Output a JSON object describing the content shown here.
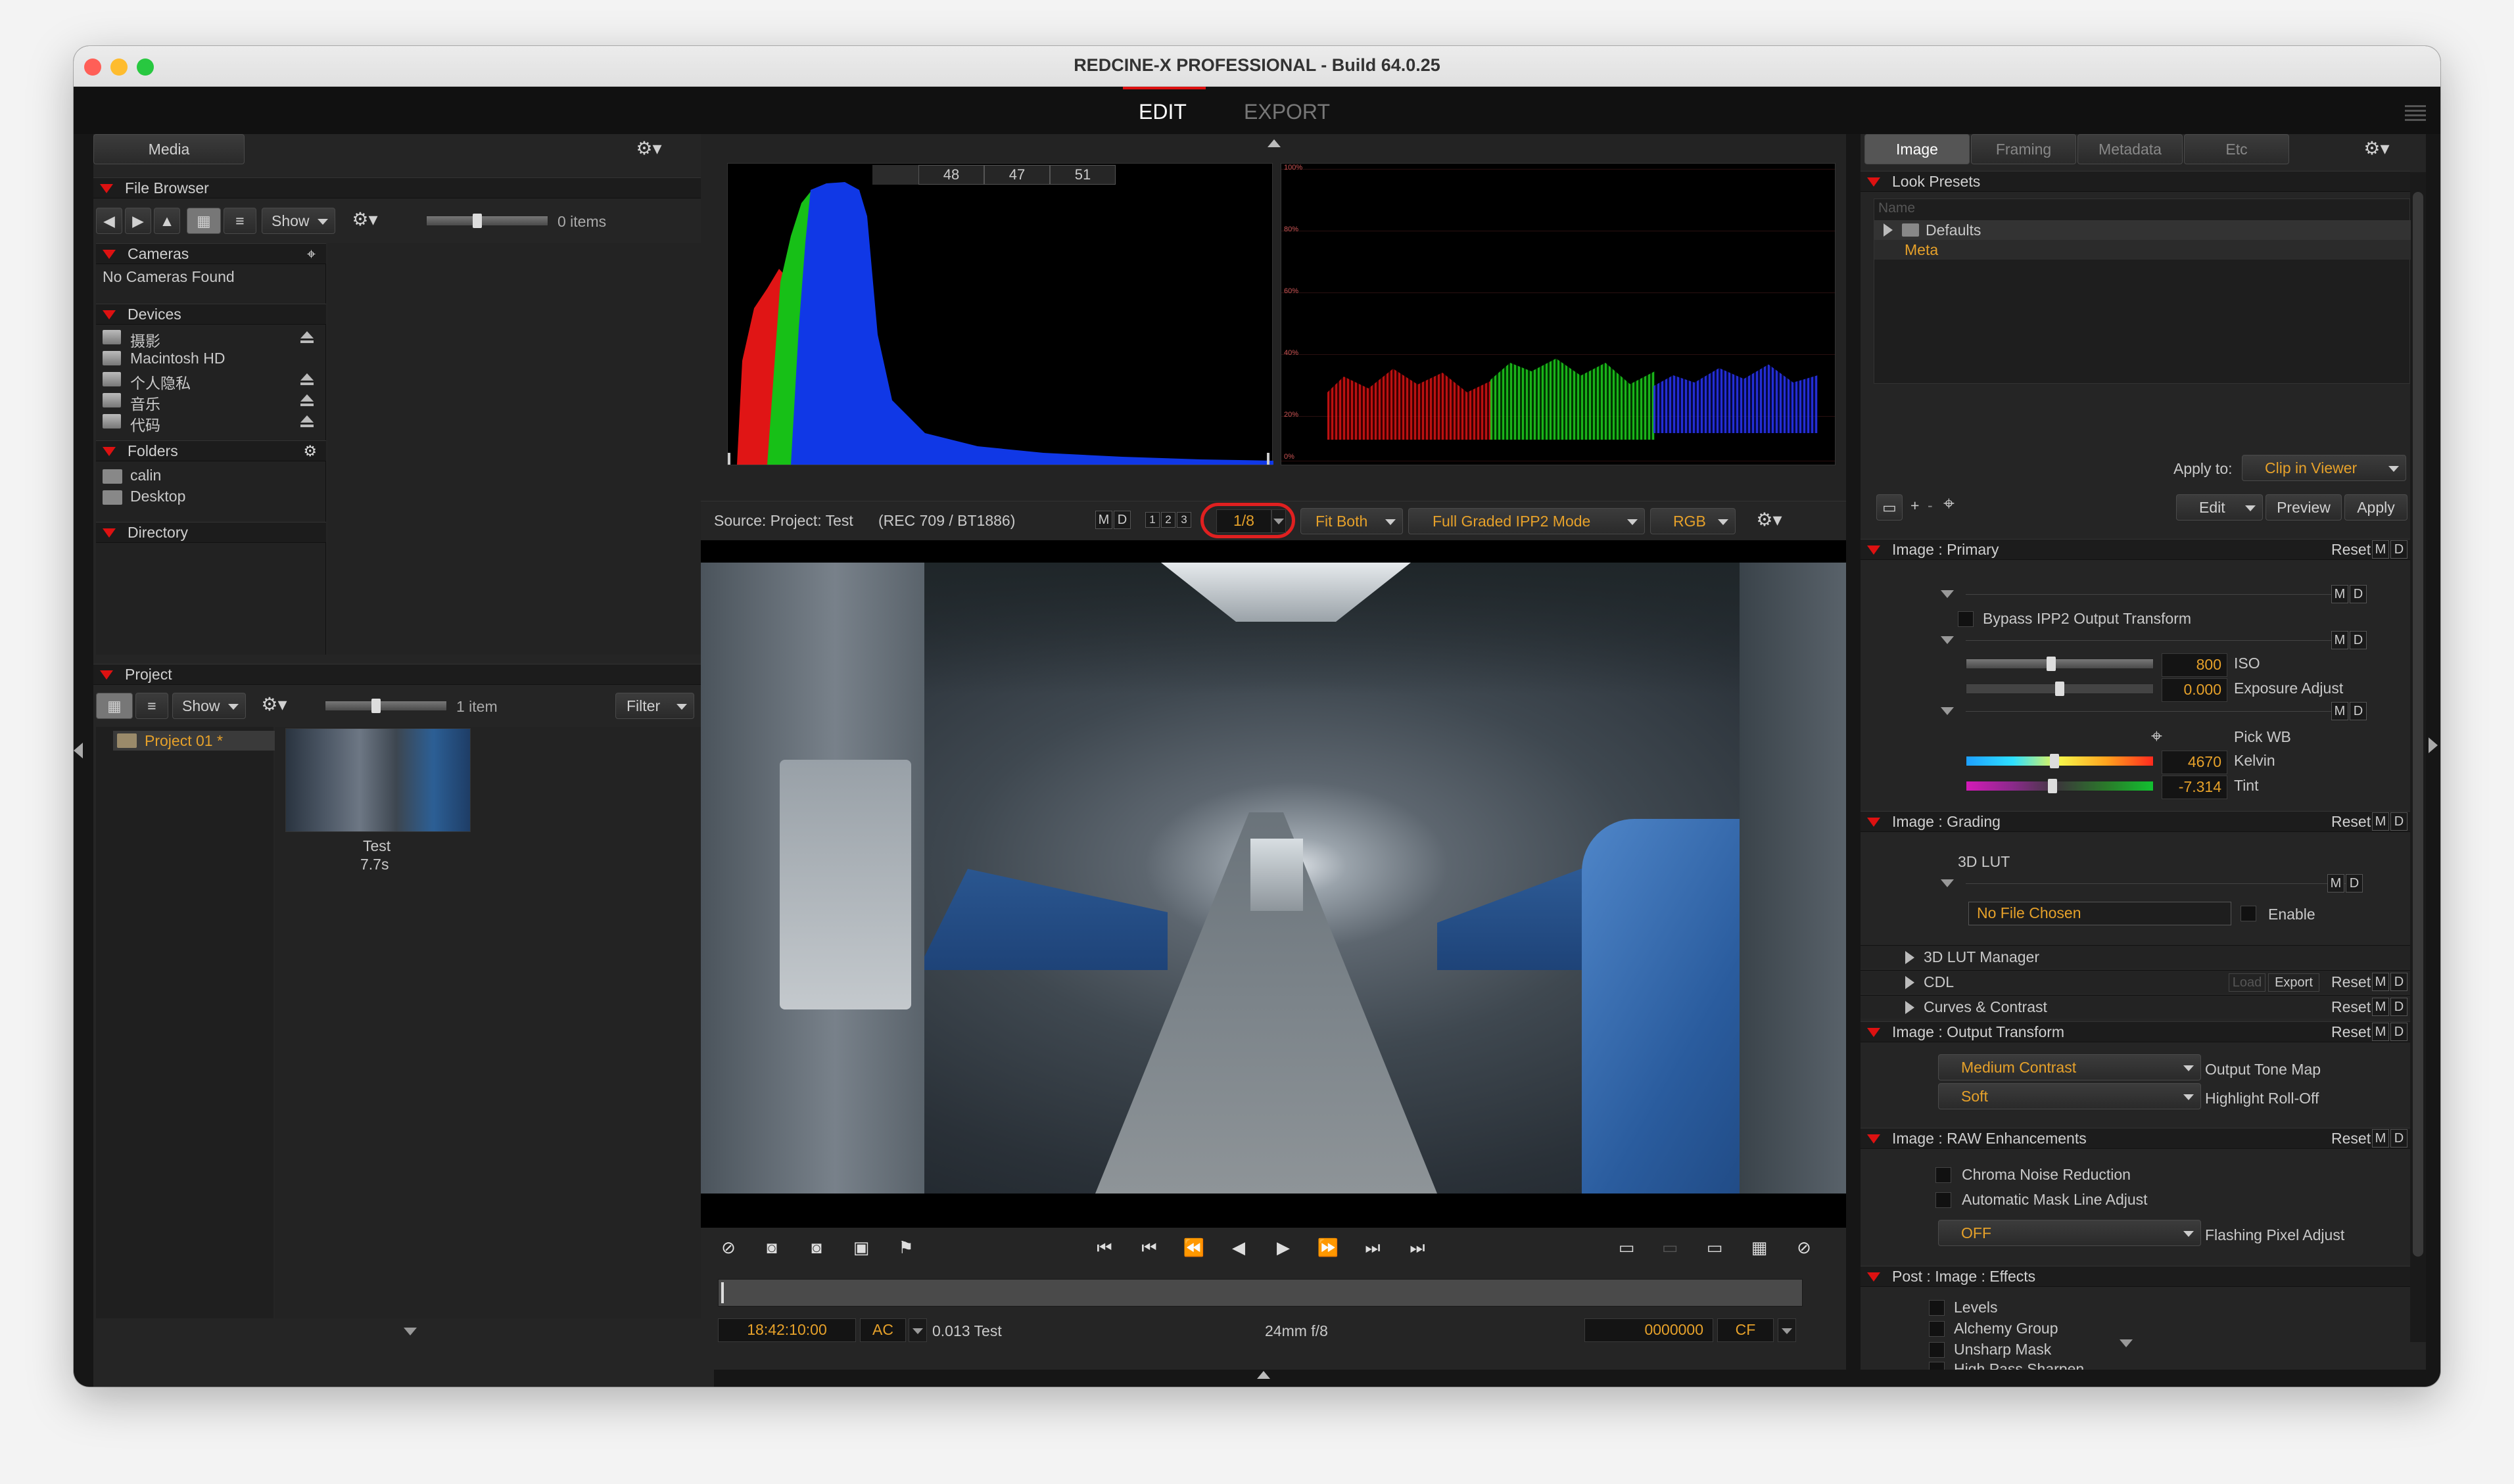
{
  "window": {
    "title": "REDCINE-X PROFESSIONAL - Build 64.0.25"
  },
  "modes": {
    "edit": "EDIT",
    "export": "EXPORT"
  },
  "left": {
    "media_tab": "Media",
    "file_browser": {
      "title": "File Browser",
      "show": "Show",
      "items_count": "0 items",
      "cameras_title": "Cameras",
      "no_cameras": "No Cameras Found",
      "devices_title": "Devices",
      "devices": [
        "摄影",
        "Macintosh HD",
        "个人隐私",
        "音乐",
        "代码"
      ],
      "folders_title": "Folders",
      "folders": [
        "calin",
        "Desktop"
      ],
      "directory_title": "Directory"
    },
    "project": {
      "title": "Project",
      "show": "Show",
      "items_count": "1 item",
      "filter": "Filter",
      "project_name": "Project 01 *",
      "clip_name": "Test",
      "clip_duration": "7.7s"
    }
  },
  "scopes": {
    "histogram_readout": [
      "48",
      "47",
      "51"
    ],
    "parade_scale": [
      "100%",
      "80%",
      "60%",
      "40%",
      "20%",
      "0%"
    ]
  },
  "viewer": {
    "source": "Source: Project: Test",
    "colorspace": "(REC 709 / BT1886)",
    "m": "M",
    "d": "D",
    "pages": [
      "1",
      "2",
      "3"
    ],
    "resolution": "1/8",
    "fit": "Fit Both",
    "mode": "Full Graded IPP2 Mode",
    "channel": "RGB"
  },
  "transport": {
    "timecode": "18:42:10:00",
    "ac": "AC",
    "clip_info": "0.013 Test",
    "lens_info": "24mm  f/8",
    "frame": "0000000",
    "cf": "CF"
  },
  "right": {
    "tabs": [
      "Image",
      "Framing",
      "Metadata",
      "Etc"
    ],
    "look_presets": {
      "title": "Look Presets",
      "name_placeholder": "Name",
      "defaults": "Defaults",
      "meta": "Meta",
      "apply_to_label": "Apply to:",
      "apply_to_value": "Clip in Viewer",
      "edit": "Edit",
      "preview": "Preview",
      "apply": "Apply"
    },
    "reset": "Reset:",
    "primary": {
      "title": "Image : Primary",
      "bypass": "Bypass IPP2 Output Transform",
      "iso_value": "800",
      "iso_label": "ISO",
      "exposure_value": "0.000",
      "exposure_label": "Exposure Adjust",
      "pick_wb": "Pick WB",
      "kelvin_value": "4670",
      "kelvin_label": "Kelvin",
      "tint_value": "-7.314",
      "tint_label": "Tint",
      "iso_level": 0.45,
      "exposure_level": 0.5,
      "kelvin_level": 0.47,
      "tint_level": 0.46
    },
    "grading": {
      "title": "Image : Grading",
      "lut_label": "3D LUT",
      "no_file": "No File Chosen",
      "enable": "Enable",
      "lut_manager": "3D LUT Manager",
      "cdl": "CDL",
      "load": "Load",
      "export": "Export",
      "curves": "Curves & Contrast"
    },
    "output": {
      "title": "Image : Output Transform",
      "tone_value": "Medium Contrast",
      "tone_label": "Output Tone Map",
      "rolloff_value": "Soft",
      "rolloff_label": "Highlight Roll-Off"
    },
    "raw": {
      "title": "Image : RAW Enhancements",
      "chroma": "Chroma Noise Reduction",
      "mask": "Automatic Mask Line Adjust",
      "flash_value": "OFF",
      "flash_label": "Flashing Pixel Adjust"
    },
    "effects": {
      "title": "Post : Image : Effects",
      "items": [
        "Levels",
        "Alchemy Group",
        "Unsharp Mask",
        "High Pass Sharpen"
      ]
    }
  },
  "colors": {
    "accent": "#e6a12a",
    "arrow": "#dd1111",
    "highlight": "#e02020"
  }
}
